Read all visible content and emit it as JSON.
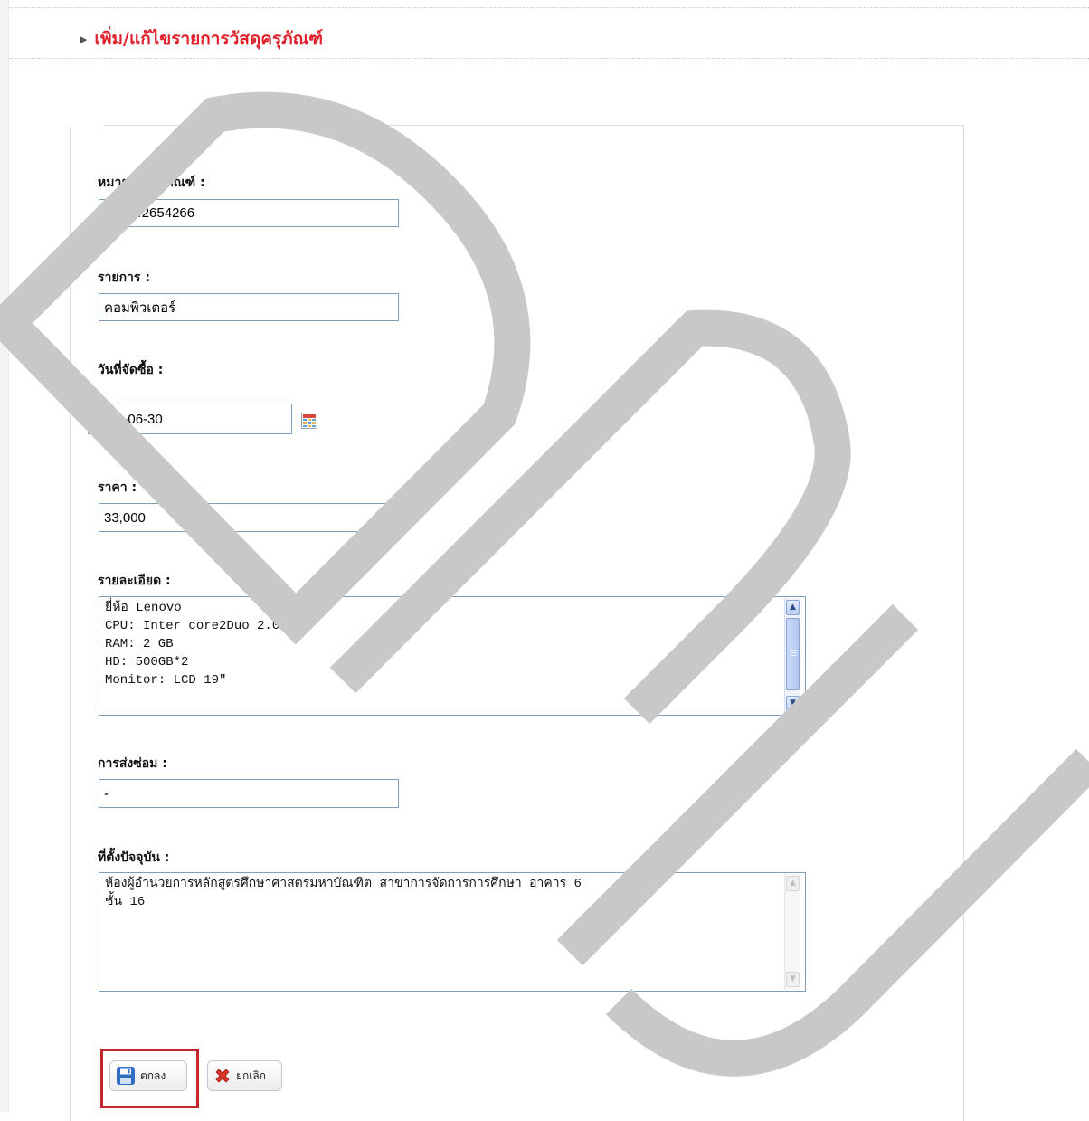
{
  "header": {
    "title": "เพิ่ม/แก้ไขรายการวัสดุครุภัณฑ์"
  },
  "form": {
    "asset_number": {
      "label": "หมายเลขครุภัณฑ์ :",
      "value": "512542654266"
    },
    "item": {
      "label": "รายการ :",
      "value": "คอมพิวเตอร์"
    },
    "purchase_date": {
      "label": "วันที่จัดซื้อ :",
      "value": "2010-06-30"
    },
    "price": {
      "label": "ราคา :",
      "value": "33,000"
    },
    "details": {
      "label": "รายละเอียด :",
      "value": "ยี่ห้อ Lenovo\nCPU: Inter core2Duo 2.0 GHz\nRAM: 2 GB\nHD: 500GB*2\nMonitor: LCD 19\""
    },
    "repair": {
      "label": "การส่งซ่อม :",
      "value": "-"
    },
    "location": {
      "label": "ที่ตั้งปัจจุบัน :",
      "value": "ห้องผู้อำนวยการหลักสูตรศึกษาศาสตรมหาบัณฑิต สาขาการจัดการการศึกษา อาคาร 6\nชั้น 16"
    }
  },
  "buttons": {
    "ok": "ตกลง",
    "cancel": "ยกเลิก"
  },
  "icons": {
    "calendar": "calendar-icon",
    "save": "floppy-disk-icon",
    "cancel": "red-x-icon"
  },
  "watermark": {
    "text": "DPU",
    "color": "#c8c8c8"
  }
}
